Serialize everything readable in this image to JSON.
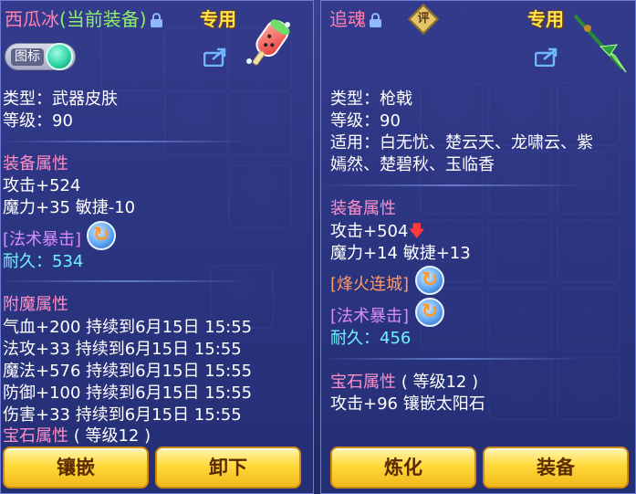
{
  "left": {
    "name": "西瓜冰",
    "equipped_tag": "(当前装备)",
    "special_label": "专用",
    "icon_toggle_label": "图标",
    "type": "类型：武器皮肤",
    "level": "等级：90",
    "equip_attr_title": "装备属性",
    "attack": "攻击+524",
    "magic_agility": "魔力+35 敏捷-10",
    "skill": "[法术暴击]",
    "durability_label": "耐久：",
    "durability_value": "534",
    "enchant_title": "附魔属性",
    "enchant_lines": [
      "气血+200 持续到6月15日 15:55",
      "法攻+33 持续到6月15日 15:55",
      "魔法+576 持续到6月15日 15:55",
      "防御+100 持续到6月15日 15:55",
      "伤害+33 持续到6月15日 15:55"
    ],
    "gem_title": "宝石属性",
    "gem_level": "( 等级12 )",
    "buttons": {
      "inlay": "镶嵌",
      "unequip": "卸下"
    }
  },
  "right": {
    "name": "追魂",
    "eval_badge": "评",
    "special_label": "专用",
    "type": "类型：枪戟",
    "level": "等级：90",
    "suitable_line1": "适用：白无忧、楚云天、龙啸云、紫",
    "suitable_line2": "嫣然、楚碧秋、玉临香",
    "equip_attr_title": "装备属性",
    "attack": "攻击+504",
    "magic_agility": "魔力+14 敏捷+13",
    "skill1": "[烽火连城]",
    "skill2": "[法术暴击]",
    "durability_label": "耐久：",
    "durability_value": "456",
    "gem_title": "宝石属性",
    "gem_level": "( 等级12 )",
    "gem_effect": "攻击+96 镶嵌太阳石",
    "buttons": {
      "refine": "炼化",
      "equip": "装备"
    }
  },
  "icons": [
    "lock-icon",
    "share-icon",
    "refresh-icon",
    "down-arrow-icon",
    "popsicle-icon",
    "spear-icon"
  ]
}
